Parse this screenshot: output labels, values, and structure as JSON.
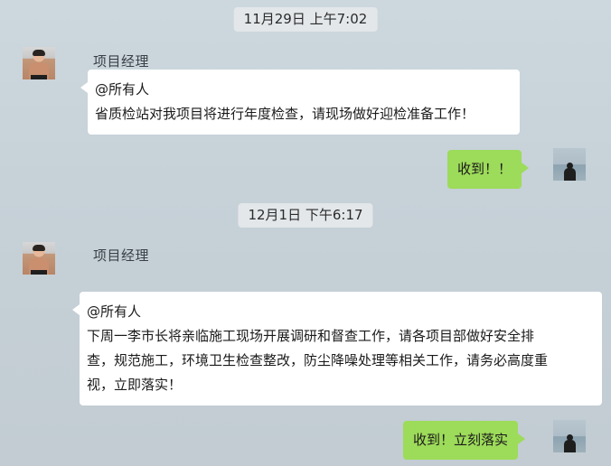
{
  "chat": {
    "messages": [
      {
        "time": "11月29日  上午7:02",
        "sender": "项目经理",
        "mention": "@所有人",
        "lines": [
          "省质检站对我项目将进行年度检查，请现场做好迎检准备工作！"
        ],
        "reply": "收到！！"
      },
      {
        "time": "12月1日  下午6:17",
        "sender": "项目经理",
        "mention": "@所有人",
        "lines": [
          "下周一李市长将亲临施工现场开展调研和督查工作，请各项目部做好安全排",
          "查，规范施工，环境卫生检查整改，防尘降噪处理等相关工作，请务必高度重",
          "视，立即落实！"
        ],
        "reply": "收到！立刻落实"
      }
    ]
  },
  "colors": {
    "background": "#c6d1d8",
    "incoming_bubble": "#ffffff",
    "outgoing_bubble": "#9ddb5a",
    "timestamp_bg": "#e3e7ea"
  },
  "icons": {
    "sender_avatar": "avatar-photo-man",
    "self_avatar": "avatar-photo-silhouette"
  }
}
